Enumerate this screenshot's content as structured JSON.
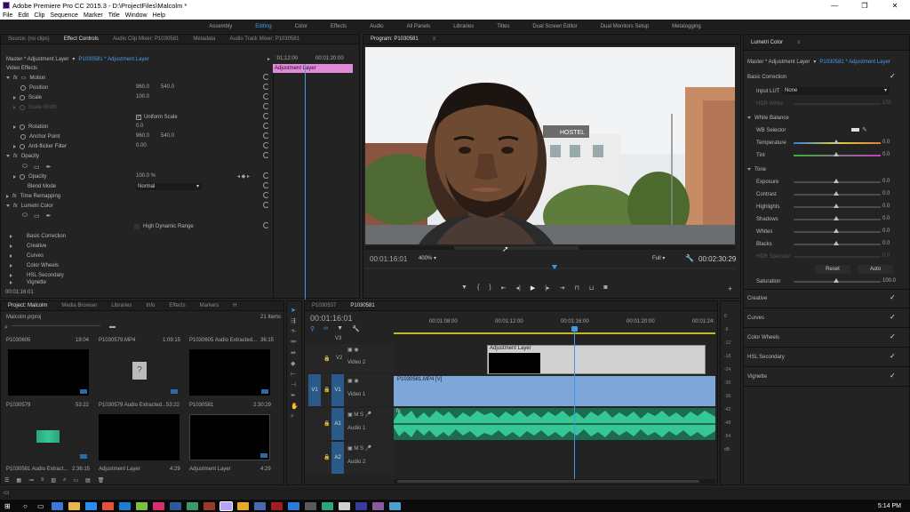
{
  "window": {
    "title": "Adobe Premiere Pro CC 2015.3 - D:\\ProjectFiles\\Malcolm *",
    "minimize": "—",
    "maximize": "❐",
    "close": "✕"
  },
  "menu": [
    "File",
    "Edit",
    "Clip",
    "Sequence",
    "Marker",
    "Title",
    "Window",
    "Help"
  ],
  "workspaces": [
    {
      "label": "Assembly",
      "active": false
    },
    {
      "label": "Editing",
      "active": true
    },
    {
      "label": "Color",
      "active": false
    },
    {
      "label": "Effects",
      "active": false
    },
    {
      "label": "Audio",
      "active": false
    },
    {
      "label": "All Panels",
      "active": false
    },
    {
      "label": "Libraries",
      "active": false
    },
    {
      "label": "Titles",
      "active": false
    },
    {
      "label": "Dual Screen Editor",
      "active": false
    },
    {
      "label": "Dual Monitors Setup",
      "active": false
    },
    {
      "label": "Metalogging",
      "active": false
    }
  ],
  "effect_controls": {
    "tabs": [
      {
        "label": "Source: (no clips)",
        "active": false
      },
      {
        "label": "Effect Controls",
        "active": true
      },
      {
        "label": "Audio Clip Mixer: P1030581",
        "active": false
      },
      {
        "label": "Metadata",
        "active": false
      },
      {
        "label": "Audio Track Mixer: P1030581",
        "active": false
      }
    ],
    "header_master": "Master * Adjustment Layer",
    "header_clip": "P1030581 * Adjustment Layer",
    "mini_timecodes": [
      ":01;12:00",
      "00:01:20:00"
    ],
    "clip_bar": "Adjustment Layer",
    "section": "Video Effects",
    "motion": "Motion",
    "position_label": "Position",
    "position_x": "960.0",
    "position_y": "540.0",
    "scale_label": "Scale",
    "scale_value": "100.0",
    "scale_width_label": "Scale Width",
    "uniform_scale": "Uniform Scale",
    "rotation_label": "Rotation",
    "rotation_value": "0.0",
    "anchor_label": "Anchor Point",
    "anchor_x": "960.0",
    "anchor_y": "540.0",
    "antiflicker_label": "Anti-flicker Filter",
    "antiflicker_value": "0.00",
    "opacity_group": "Opacity",
    "opacity_label": "Opacity",
    "opacity_value": "100.0 %",
    "blend_label": "Blend Mode",
    "blend_value": "Normal",
    "time_remap": "Time Remapping",
    "lumetri": "Lumetri Color",
    "hdr": "High Dynamic Range",
    "lumetri_items": [
      "Basic Correction",
      "Creative",
      "Curves",
      "Color Wheels",
      "HSL Secondary",
      "Vignette"
    ],
    "timecode": "00:01:16:01"
  },
  "program": {
    "tab": "Program: P1030581",
    "timecode": "00:01:16:01",
    "zoom": "400%",
    "quality": "Full",
    "duration": "00:02:30:29",
    "sign_text": "HOSTEL"
  },
  "project": {
    "tabs": [
      {
        "label": "Project: Malcolm",
        "active": true
      },
      {
        "label": "Media Browser",
        "active": false
      },
      {
        "label": "Libraries",
        "active": false
      },
      {
        "label": "Info",
        "active": false
      },
      {
        "label": "Effects",
        "active": false
      },
      {
        "label": "Markers",
        "active": false
      },
      {
        "label": "H",
        "active": false
      }
    ],
    "file": "Malcolm.prproj",
    "item_count": "21 Items",
    "items": [
      {
        "name": "P1030605",
        "dur": "18:04"
      },
      {
        "name": "P1030579.MP4",
        "dur": "1:09:15"
      },
      {
        "name": "P1030605 Audio Extracted...",
        "dur": "36:15"
      },
      {
        "name": "P1030579",
        "dur": "53:22"
      },
      {
        "name": "P1030579 Audio Extracted...",
        "dur": "53:22"
      },
      {
        "name": "P1030581",
        "dur": "2:30:29"
      },
      {
        "name": "P1030581 Audio Extract...",
        "dur": "2:36:15"
      },
      {
        "name": "Adjustment Layer",
        "dur": "4:29"
      },
      {
        "name": "Adjustment Layer",
        "dur": "4:29"
      }
    ]
  },
  "timeline": {
    "tabs": [
      {
        "label": "P1030537",
        "active": false
      },
      {
        "label": "P1030581",
        "active": true
      }
    ],
    "timecode": "00:01:16:01",
    "ruler": [
      "00:01:08:00",
      "00:01:12:00",
      "00:01:16:00",
      "00:01:20:00",
      "00:01:24:"
    ],
    "tracks": [
      {
        "id": "V3",
        "name": ""
      },
      {
        "id": "V2",
        "name": "Video 2"
      },
      {
        "id": "V1",
        "name": "Video 1"
      },
      {
        "id": "A1",
        "name": "Audio 1"
      },
      {
        "id": "A2",
        "name": "Audio 2"
      }
    ],
    "adj_clip": "Adjustment Layer",
    "video_clip": "P1030581.MP4 [V]",
    "meter_labels": [
      "0",
      "-6",
      "-12",
      "-18",
      "-24",
      "-30",
      "-36",
      "-42",
      "-48",
      "-54",
      "dB"
    ]
  },
  "lumetri_panel": {
    "tab": "Lumetri Color",
    "header_master": "Master * Adjustment Layer",
    "header_clip": "P1030581 * Adjustment Layer",
    "basic": "Basic Correction",
    "input_lut_label": "Input LUT",
    "input_lut_value": "None",
    "hdr_white": "HDR White",
    "hdr_white_value": "100",
    "white_balance": "White Balance",
    "wb_selector": "WB Selector",
    "temperature": "Temperature",
    "temperature_value": "0.0",
    "tint": "Tint",
    "tint_value": "0.0",
    "tone": "Tone",
    "exposure": "Exposure",
    "exposure_value": "0.0",
    "contrast": "Contrast",
    "contrast_value": "0.0",
    "highlights": "Highlights",
    "highlights_value": "0.0",
    "shadows": "Shadows",
    "shadows_value": "0.0",
    "whites": "Whites",
    "whites_value": "0.0",
    "blacks": "Blacks",
    "blacks_value": "0.0",
    "hdr_specular": "HDR Specular",
    "hdr_specular_value": "0.0",
    "reset": "Reset",
    "auto": "Auto",
    "saturation": "Saturation",
    "saturation_value": "100.0",
    "sections": [
      "Creative",
      "Curves",
      "Color Wheels",
      "HSL Secondary",
      "Vignette"
    ]
  },
  "taskbar": {
    "clock": "5:14 PM"
  },
  "colors": {
    "accent": "#4a9ee8",
    "adjustment": "#e08ad8",
    "video_clip": "#7ea6d9",
    "audio_clip": "#2aa57e",
    "playhead": "#3e9ae6"
  }
}
